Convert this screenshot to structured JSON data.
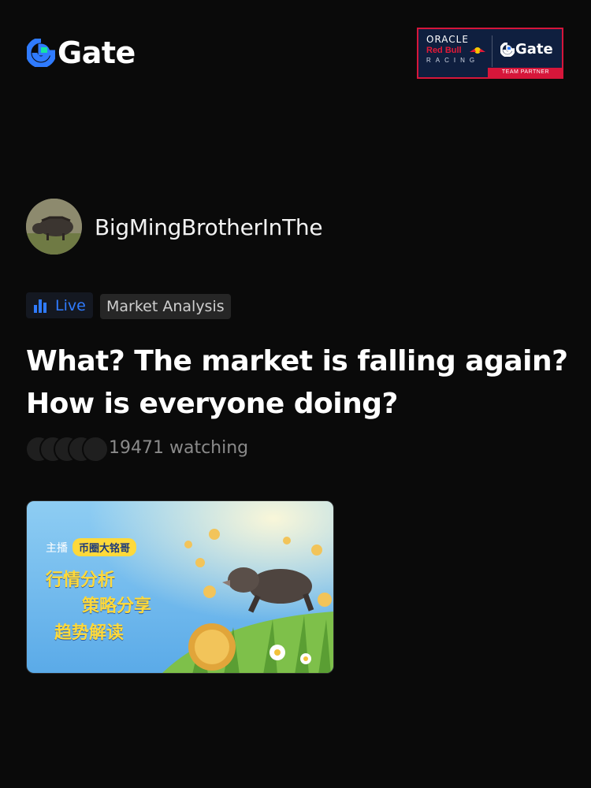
{
  "header": {
    "logo_text": "Gate",
    "partner": {
      "oracle": "ORACLE",
      "redbull": "Red Bull",
      "racing": "RACING",
      "gate": "Gate",
      "team": "TEAM PARTNER"
    }
  },
  "host": {
    "name": "BigMingBrotherInThe"
  },
  "tags": {
    "live": "Live",
    "category": "Market Analysis"
  },
  "stream": {
    "title": "What? The market is falling again? How is everyone doing?",
    "watching": "19471 watching"
  },
  "cover": {
    "host_label": "主播",
    "host_badge": "币圈大铭哥",
    "line1": "行情分析",
    "line2": "策略分享",
    "line3": "趋势解读"
  },
  "colors": {
    "background": "#0a0a0a",
    "accent_blue": "#2f7bff",
    "logo_green": "#17e5a0",
    "partner_red": "#d6163a"
  },
  "icons": {
    "logo": "gate-logo-icon",
    "live": "live-bars-icon"
  }
}
